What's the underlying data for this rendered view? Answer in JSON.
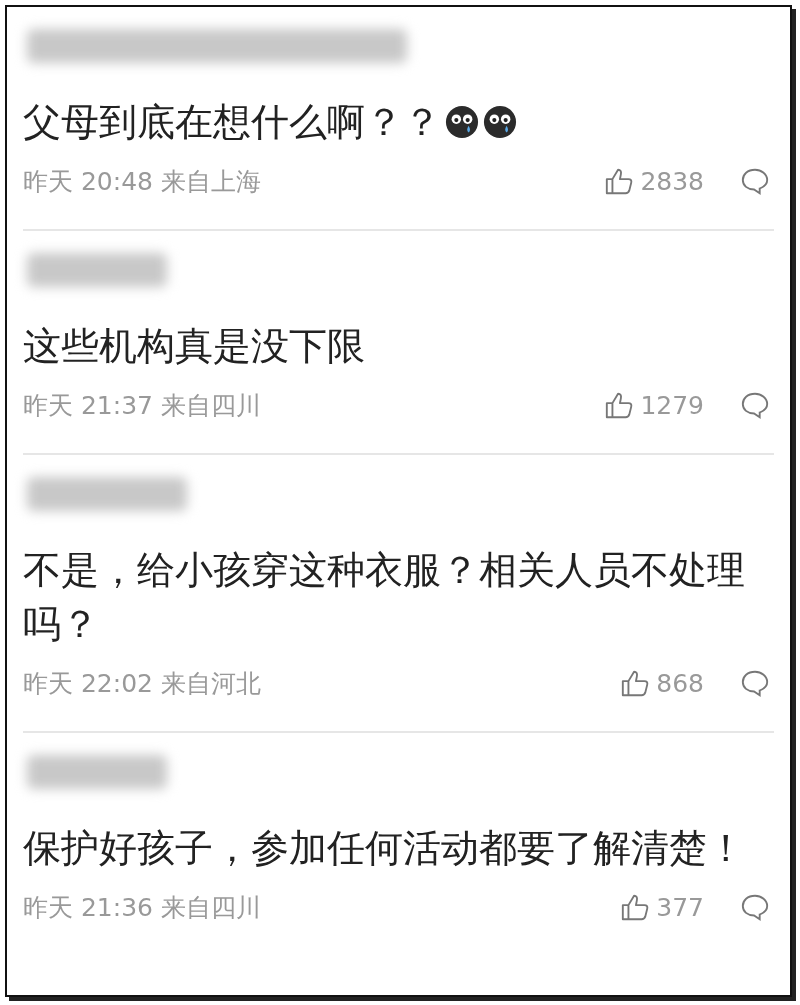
{
  "comments": [
    {
      "text": "父母到底在想什么啊？？",
      "emojis": [
        {
          "kind": "tear"
        },
        {
          "kind": "tear"
        }
      ],
      "time": "昨天 20:48 来自上海",
      "likes": "2838"
    },
    {
      "text": "这些机构真是没下限",
      "time": "昨天 21:37 来自四川",
      "likes": "1279"
    },
    {
      "text": "不是，给小孩穿这种衣服？相关人员不处理吗？",
      "time": "昨天 22:02 来自河北",
      "likes": "868"
    },
    {
      "text": "保护好孩子，参加任何活动都要了解清楚！",
      "time": "昨天 21:36 来自四川",
      "likes": "377"
    }
  ]
}
